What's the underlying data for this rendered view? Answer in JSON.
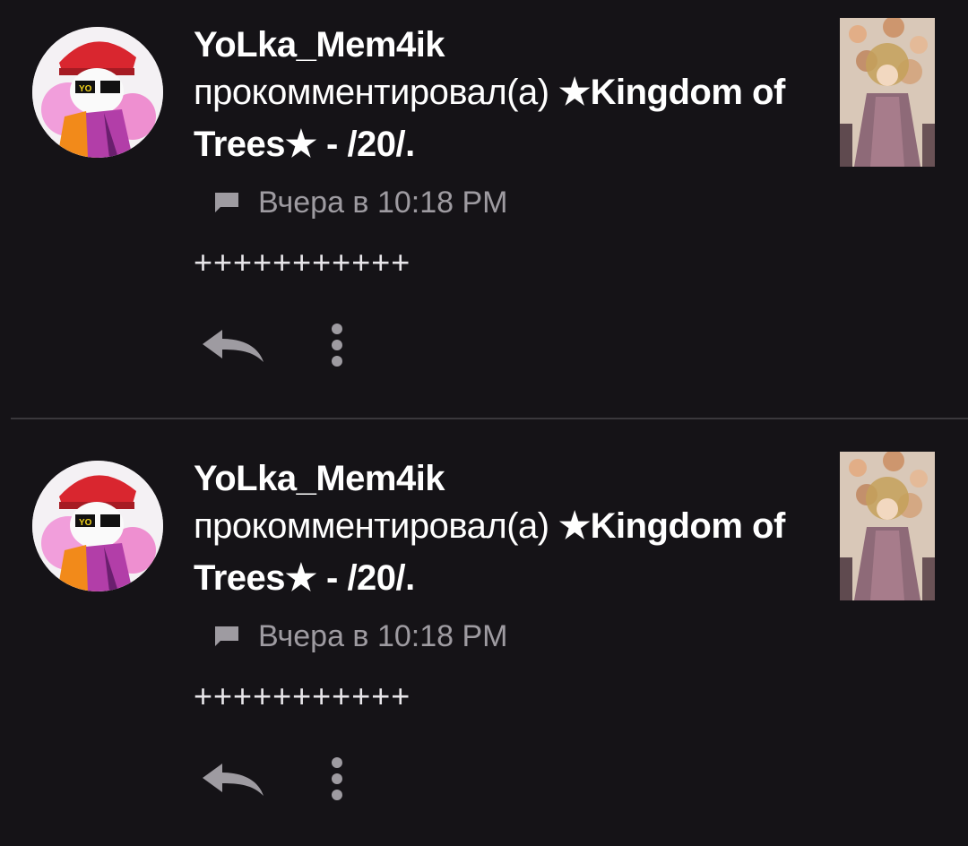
{
  "notifications": [
    {
      "username": "YoLka_Mem4ik",
      "action_text": "прокомментировал(а) ",
      "post_title": "★Kingdom of Trees★ - /20/.",
      "timestamp": "Вчера в 10:18 PM",
      "comment_text": "+++++++++++",
      "avatar_badge": "YO",
      "icons": [
        "comment-icon",
        "reply-icon",
        "more-vertical-icon"
      ]
    },
    {
      "username": "YoLka_Mem4ik",
      "action_text": "прокомментировал(а) ",
      "post_title": "★Kingdom of Trees★ - /20/.",
      "timestamp": "Вчера в 10:18 PM",
      "comment_text": "+++++++++++",
      "avatar_badge": "YO",
      "icons": [
        "comment-icon",
        "reply-icon",
        "more-vertical-icon"
      ]
    }
  ],
  "colors": {
    "background": "#151317",
    "primary_text": "#ffffff",
    "secondary_text": "#9e9ba1",
    "icon": "#9e9ba1",
    "divider": "#3a383c"
  }
}
